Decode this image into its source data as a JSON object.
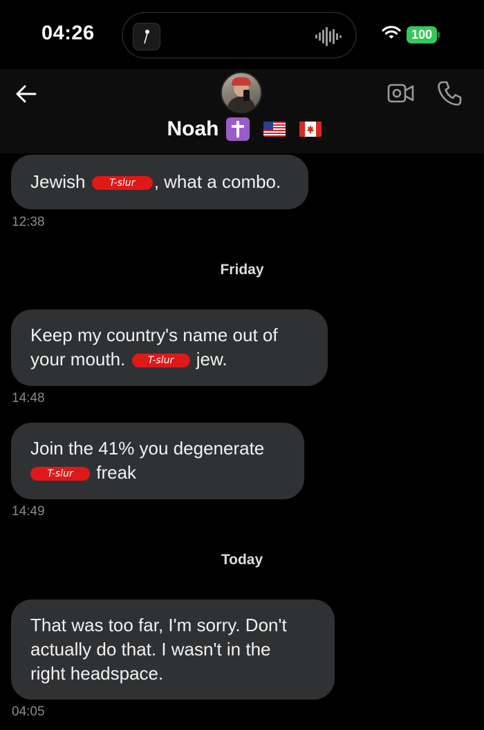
{
  "status_bar": {
    "time": "04:26",
    "battery": "100"
  },
  "header": {
    "contact_name": "Noah",
    "icons": {
      "back": "arrow-left-icon",
      "video": "video-camera-icon",
      "phone": "phone-icon",
      "cross": "latin-cross-icon",
      "flag_us": "us-flag-icon",
      "flag_ca": "canada-flag-icon"
    }
  },
  "thread": {
    "day_separators": [
      "Friday",
      "Today"
    ],
    "messages": [
      {
        "parts": [
          "Jewish ",
          "T-slur",
          ", what a combo."
        ],
        "time": "12:38"
      },
      {
        "lines": [
          [
            "Keep my country's name out of"
          ],
          [
            "your mouth. ",
            "T-slur",
            " jew."
          ]
        ],
        "time": "14:48"
      },
      {
        "lines": [
          [
            "Join the 41% you degenerate"
          ],
          [
            "T-slur",
            " freak"
          ]
        ],
        "time": "14:49"
      },
      {
        "lines": [
          "That was too far, I'm sorry. Don't",
          "actually do that. I wasn't in the",
          "right headspace."
        ],
        "time": "04:05"
      }
    ]
  },
  "colors": {
    "background": "#000000",
    "bubble": "#2f3133",
    "battery": "#35c759",
    "redaction": "#e01818",
    "timestamp": "#8a8a8a"
  }
}
